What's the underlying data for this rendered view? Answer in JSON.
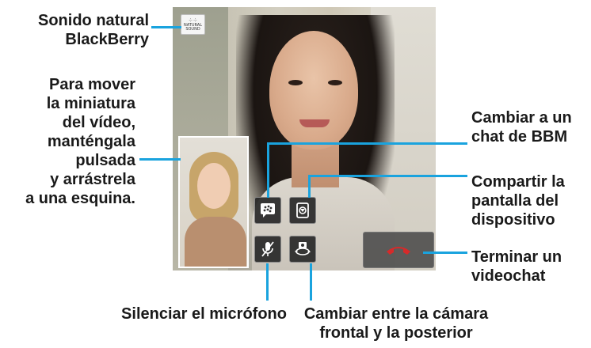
{
  "labels": {
    "natural_sound": [
      "Sonido natural",
      "BlackBerry"
    ],
    "move_thumbnail": [
      "Para mover",
      "la miniatura",
      "del vídeo,",
      "manténgala",
      "pulsada",
      "y arrástrela",
      "a una esquina."
    ],
    "bbm_chat": [
      "Cambiar a un",
      "chat de BBM"
    ],
    "share_screen": [
      "Compartir la",
      "pantalla del",
      "dispositivo"
    ],
    "end_video_chat": [
      "Terminar un",
      "videochat"
    ],
    "mute_mic": "Silenciar el micrófono",
    "switch_camera": [
      "Cambiar entre la cámara",
      "frontal y la posterior"
    ]
  },
  "screen": {
    "natural_sound_badge": [
      "NATURAL",
      "SOUND"
    ]
  },
  "colors": {
    "callout_line": "#1aa3de",
    "end_call_red": "#d62a2a"
  },
  "icons": {
    "bbm": "bbm-chat-icon",
    "share": "share-screen-icon",
    "mute": "mute-microphone-icon",
    "switch": "switch-camera-icon",
    "end": "end-call-icon",
    "natural_sound": "natural-sound-icon"
  }
}
